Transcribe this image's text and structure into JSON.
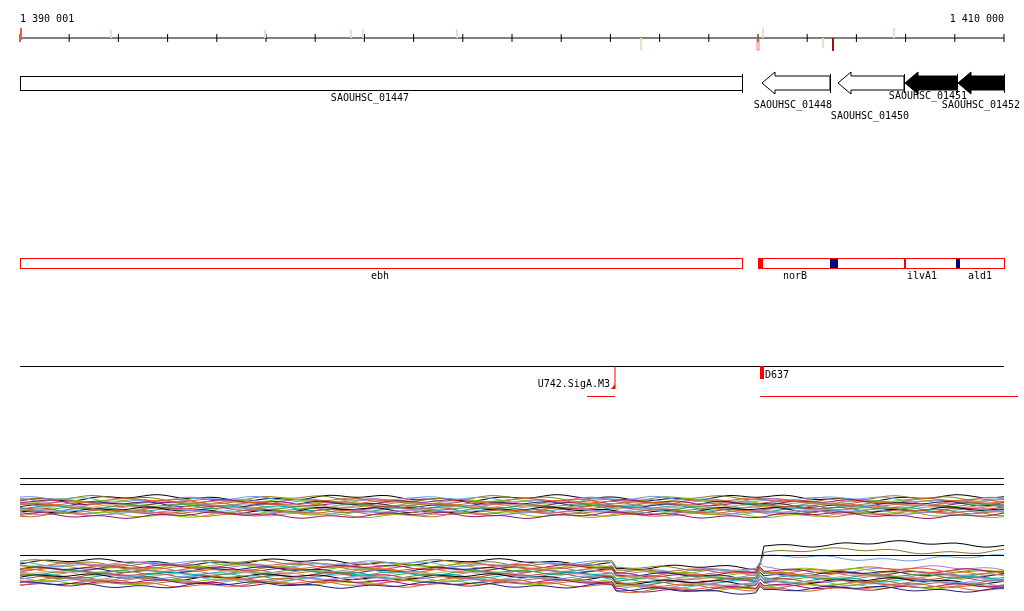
{
  "ruler": {
    "start_label": "1 390 001",
    "end_label": "1 410 000"
  },
  "genes": [
    {
      "label": "SAOUHSC_01447",
      "filled": false
    },
    {
      "label": "SAOUHSC_01448",
      "filled": false
    },
    {
      "label": "SAOUHSC_01450",
      "filled": false
    },
    {
      "label": "SAOUHSC_01451",
      "filled": true
    },
    {
      "label": "SAOUHSC_01452",
      "filled": true
    }
  ],
  "annotations": [
    {
      "label": "ebh"
    },
    {
      "label": "norB"
    },
    {
      "label": "ilvA1"
    },
    {
      "label": "ald1"
    }
  ],
  "sites": [
    {
      "label": "U742.SigA.M3"
    },
    {
      "label": "D637"
    }
  ]
}
